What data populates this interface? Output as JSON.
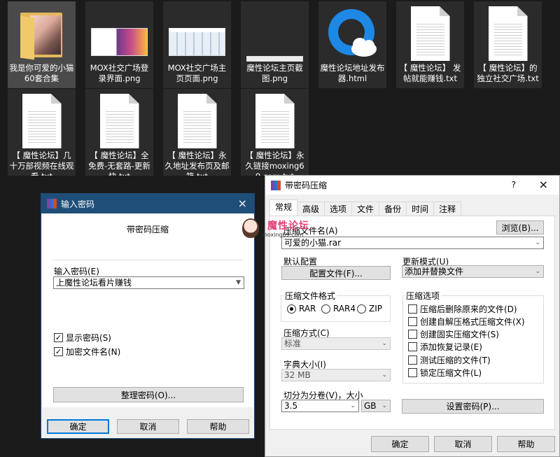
{
  "files": [
    {
      "name": "我是你可爱的小猫60套合集",
      "type": "folder"
    },
    {
      "name": "MOX社交广场登录界面.png",
      "type": "png"
    },
    {
      "name": "MOX社交广场主页页面.png",
      "type": "png"
    },
    {
      "name": "魔性论坛主页截图.png",
      "type": "png"
    },
    {
      "name": "魔性论坛地址发布器.html",
      "type": "html"
    },
    {
      "name": "【 魔性论坛】 发帖就能赚钱.txt",
      "type": "txt"
    },
    {
      "name": "【 魔性论坛】的独立社交广场.txt",
      "type": "txt"
    },
    {
      "name": "【 魔性论坛】几十万部视频在线观看.txt",
      "type": "txt"
    },
    {
      "name": "【 魔性论坛】全免费-无套路-更新快.txt",
      "type": "txt"
    },
    {
      "name": "【 魔性论坛】永久地址发布页及邮箱.txt",
      "type": "txt"
    },
    {
      "name": "【 魔性论坛】永久链接moxing69.com.txt",
      "type": "txt"
    }
  ],
  "password_dialog": {
    "title": "输入密码",
    "close": "×",
    "subtitle": "带密码压缩",
    "input_label": "输入密码(E)",
    "input_value": "上魔性论坛看片赚钱",
    "show_password": "显示密码(S)",
    "encrypt_names": "加密文件名(N)",
    "organize_button": "整理密码(O)...",
    "ok": "确定",
    "cancel": "取消",
    "help": "帮助"
  },
  "watermark": {
    "title": "魔性论坛",
    "url": "moxing69.com"
  },
  "archive_dialog": {
    "title": "带密码压缩",
    "help_glyph": "?",
    "close": "×",
    "tabs": [
      "常规",
      "高级",
      "选项",
      "文件",
      "备份",
      "时间",
      "注释"
    ],
    "archive_name_label": "压缩文件名(A)",
    "archive_name_value": "可爱的小猫.rar",
    "browse_button": "浏览(B)...",
    "default_config_label": "默认配置",
    "profiles_button": "配置文件(F)...",
    "update_mode_label": "更新模式(U)",
    "update_mode_value": "添加并替换文件",
    "format_group": "压缩文件格式",
    "formats": [
      {
        "label": "RAR",
        "selected": true
      },
      {
        "label": "RAR4",
        "selected": false
      },
      {
        "label": "ZIP",
        "selected": false
      }
    ],
    "options_group": "压缩选项",
    "options": [
      "压缩后删除原来的文件(D)",
      "创建自解压格式压缩文件(X)",
      "创建固实压缩文件(S)",
      "添加恢复记录(E)",
      "测试压缩的文件(T)",
      "锁定压缩文件(L)"
    ],
    "method_label": "压缩方式(C)",
    "method_value": "标准",
    "dict_label": "字典大小(I)",
    "dict_value": "32 MB",
    "split_label": "切分为分卷(V)，大小",
    "split_value": "3.5",
    "split_unit": "GB",
    "set_password_button": "设置密码(P)...",
    "ok": "确定",
    "cancel": "取消",
    "help": "帮助"
  },
  "colors": {
    "accent": "#0078d7",
    "desktop": "#1b1b1b",
    "watermark": "#e0417a"
  }
}
